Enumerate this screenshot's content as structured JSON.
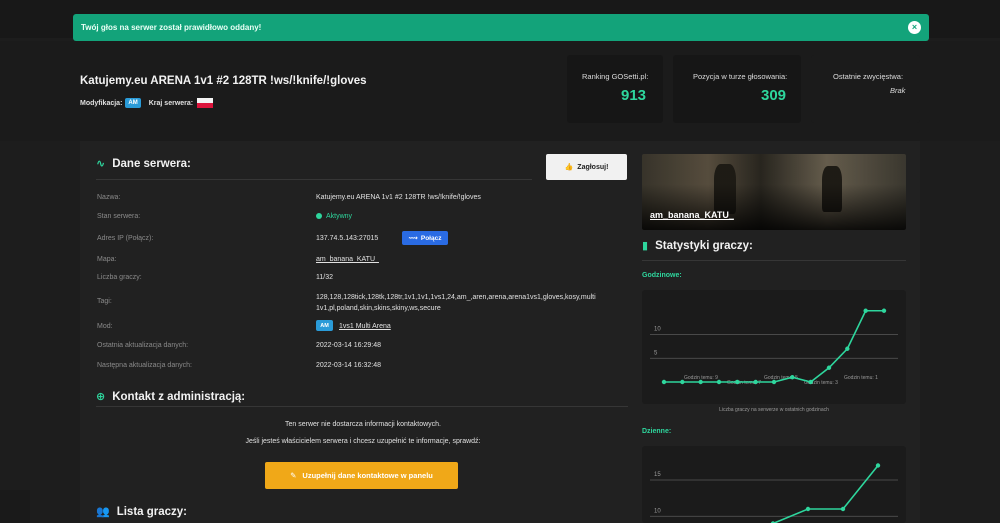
{
  "alert": {
    "message": "Twój głos na serwer został prawidłowo oddany!",
    "close_icon": "×"
  },
  "server": {
    "title": "Katujemy.eu ARENA 1v1 #2 128TR !ws/!knife/!gloves",
    "modification_label": "Modyfikacja:",
    "modification_value": "AM",
    "country_label": "Kraj serwera:"
  },
  "stats": [
    {
      "label": "Ranking GOSetti.pl:",
      "value": "913"
    },
    {
      "label": "Pozycja w turze głosowania:",
      "value": "309"
    },
    {
      "label": "Ostatnie zwycięstwa:",
      "value": "Brak"
    }
  ],
  "details": {
    "title": "Dane serwera:",
    "vote_button": "Zagłosuj!",
    "rows": [
      {
        "label": "Nazwa:",
        "value": "Katujemy.eu ARENA 1v1 #2 128TR !ws/!knife/!gloves"
      },
      {
        "label": "Stan serwera:",
        "value": "Aktywny"
      },
      {
        "label": "Adres IP (Połącz):",
        "value": "137.74.5.143:27015"
      },
      {
        "label": "Mapa:",
        "value": "am_banana_KATU_"
      },
      {
        "label": "Liczba graczy:",
        "value": "11/32"
      },
      {
        "label": "Tagi:",
        "value": "128,128,128tick,128tk,128tr,1v1,1v1,1vs1,24,am_,aren,arena,arena1vs1,gloves,kosy,multi 1v1,pl,poland,skin,skins,skiny,ws,secure"
      },
      {
        "label": "Mod:",
        "value": "1vs1 Multi Arena",
        "badge": "AM"
      },
      {
        "label": "Ostatnia aktualizacja danych:",
        "value": "2022-03-14 16:29:48"
      },
      {
        "label": "Następna aktualizacja danych:",
        "value": "2022-03-14 16:32:48"
      }
    ],
    "connect_button": "Połącz"
  },
  "contact": {
    "title": "Kontakt z administracją:",
    "line1": "Ten serwer nie dostarcza informacji kontaktowych.",
    "line2": "Jeśli jesteś właścicielem serwera i chcesz uzupełnić te informacje, sprawdź:",
    "button": "Uzupełnij dane kontaktowe w panelu"
  },
  "players": {
    "title": "Lista graczy:"
  },
  "map_banner": {
    "name": "am_banana_KATU_"
  },
  "stats_panel": {
    "title": "Statystyki graczy:",
    "hourly_label": "Godzinowe:",
    "daily_label": "Dzienne:",
    "hourly_caption": "Liczba graczy na serwerze w ostatnich godzinach"
  },
  "colors": {
    "accent": "#2ed69d",
    "alert": "#13a37a",
    "connect": "#2a6be3",
    "warning": "#f0a818",
    "mod_badge": "#2a9bd8"
  },
  "chart_data": [
    {
      "type": "line",
      "title": "Godzinowe:",
      "x": [
        "",
        "",
        "",
        "",
        "",
        "",
        "",
        "",
        "",
        "",
        "",
        "",
        ""
      ],
      "tick_labels": [
        "Godzin temu: 9",
        "Godzin temu: 7",
        "Godzin temu: 5",
        "Godzin temu: 3",
        "Godzin temu: 1"
      ],
      "values": [
        0,
        0,
        0,
        0,
        0,
        0,
        0,
        1,
        0,
        3,
        7,
        15,
        15
      ],
      "ylim": [
        0,
        16
      ],
      "yticks": [
        5,
        10
      ],
      "grid": true,
      "color": "#2ed69d"
    },
    {
      "type": "line",
      "title": "Dzienne:",
      "values": [
        7,
        9,
        11,
        11,
        17
      ],
      "ylim": [
        7,
        19
      ],
      "yticks": [
        10,
        15
      ],
      "grid": true,
      "color": "#2ed69d"
    }
  ]
}
